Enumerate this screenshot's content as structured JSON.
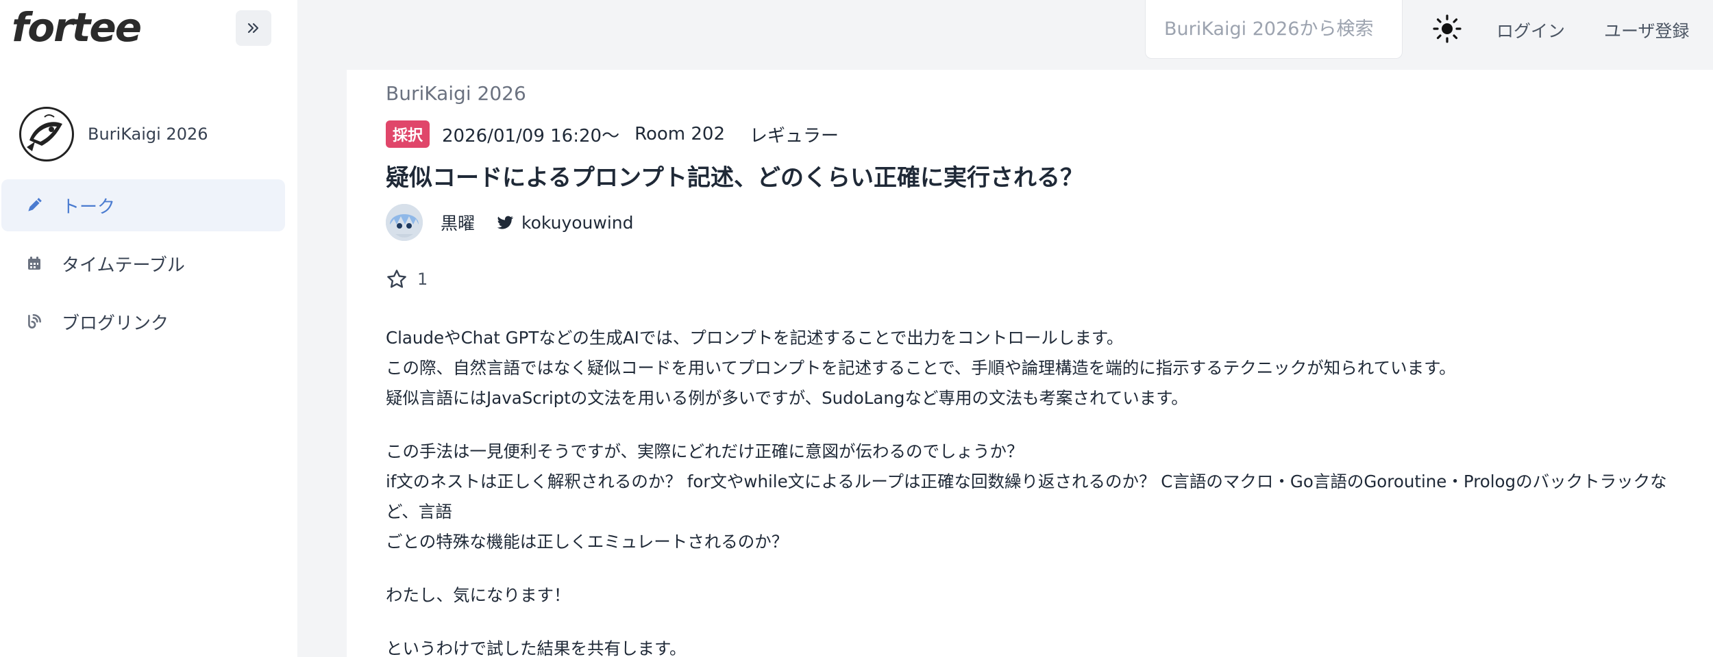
{
  "app": {
    "logo": "fortee"
  },
  "sidebar": {
    "event_name": "BuriKaigi 2026",
    "items": [
      {
        "label": "トーク",
        "icon": "pen-icon",
        "active": true
      },
      {
        "label": "タイムテーブル",
        "icon": "calendar-icon",
        "active": false
      },
      {
        "label": "ブログリンク",
        "icon": "blog-link-icon",
        "active": false
      }
    ]
  },
  "header": {
    "search_placeholder": "BuriKaigi 2026から検索",
    "login": "ログイン",
    "register": "ユーザ登録"
  },
  "talk": {
    "breadcrumb": "BuriKaigi 2026",
    "status_badge": "採択",
    "datetime": "2026/01/09 16:20〜",
    "room": "Room 202",
    "track": "レギュラー",
    "title": "疑似コードによるプロンプト記述、どのくらい正確に実行される？",
    "speaker_name": "黒曜",
    "twitter_handle": "kokuyouwind",
    "star_count": "1",
    "description": {
      "p1": [
        "ClaudeやChat GPTなどの生成AIでは、プロンプトを記述することで出力をコントロールします。",
        "この際、自然言語ではなく疑似コードを用いてプロンプトを記述することで、手順や論理構造を端的に指示するテクニックが知られています。",
        "疑似言語にはJavaScriptの文法を用いる例が多いですが、SudoLangなど専用の文法も考案されています。"
      ],
      "p2": [
        "この手法は一見便利そうですが、実際にどれだけ正確に意図が伝わるのでしょうか？",
        "if文のネストは正しく解釈されるのか？ for文やwhile文によるループは正確な回数繰り返されるのか？ C言語のマクロ・Go言語のGoroutine・Prologのバックトラックなど、言語",
        "ごとの特殊な機能は正しくエミュレートされるのか？"
      ],
      "p3": "わたし、気になります！",
      "p4": "というわけで試した結果を共有します。"
    }
  },
  "colors": {
    "accent": "#4a7bd0",
    "badge": "#e0466a",
    "background": "#f3f4f6"
  }
}
